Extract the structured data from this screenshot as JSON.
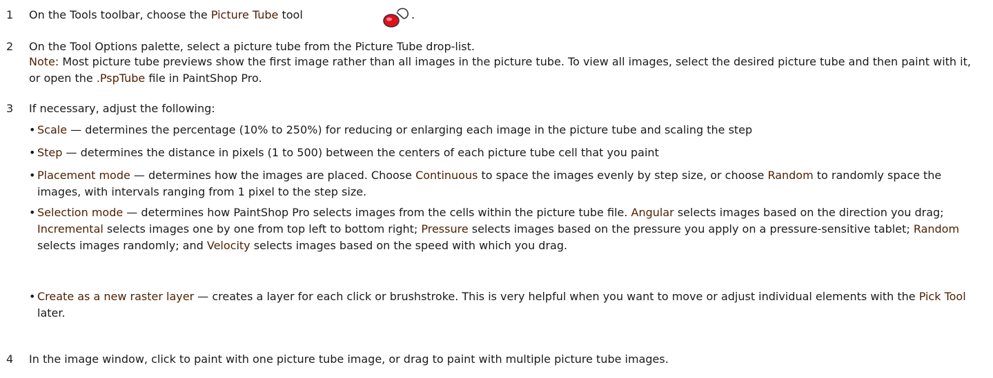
{
  "steps": [
    {
      "n": "1",
      "text": {
        "a": "On the Tools toolbar, choose the ",
        "b": "Picture Tube",
        "c": " tool ",
        "d": "."
      }
    },
    {
      "n": "2",
      "text": "On the Tool Options palette, select a picture tube from the Picture Tube drop-list.",
      "note": {
        "label": "Note",
        "sep": ":",
        "a": " Most picture tube previews show the first image rather than all images in the picture tube. To view all images, select the desired picture tube and then paint with it, or open the ",
        "kw": ".PspTube",
        "b": " file in PaintShop Pro."
      }
    },
    {
      "n": "3",
      "text": "If necessary, adjust the following:"
    },
    {
      "n": "4",
      "text": "In the image window, click to paint with one picture tube image, or drag to paint with multiple picture tube images."
    }
  ],
  "bullets": {
    "scale": {
      "kw": "Scale",
      "rest": " — determines the percentage (10% to 250%) for reducing or enlarging each image in the picture tube and scaling the step"
    },
    "step": {
      "kw": "Step",
      "rest": " — determines the distance in pixels (1 to 500) between the centers of each picture tube cell that you paint"
    },
    "placement": {
      "kw": "Placement mode",
      "a": " — determines how the images are placed. Choose ",
      "kw2": "Continuous",
      "b": " to space the images evenly by step size, or choose ",
      "kw3": "Random",
      "c": " to randomly space the images, with intervals ranging from 1 pixel to the step size."
    },
    "selection": {
      "kw": "Selection mode",
      "a": " — determines how PaintShop Pro selects images from the cells within the picture tube file. ",
      "k1": "Angular",
      "b": " selects images based on the direction you drag; ",
      "k2": "Incremental",
      "c": " selects images one by one from top left to bottom right; ",
      "k3": "Pressure",
      "d": " selects images based on the pressure you apply on a pressure-sensitive tablet; ",
      "k4": "Random",
      "e": " selects images randomly; and ",
      "k5": "Velocity",
      "f": " selects images based on the speed with which you drag."
    },
    "raster": {
      "kw": "Create as a new raster layer",
      "a": " — creates a layer for each click or brushstroke. This is very helpful when you want to move or adjust individual elements with the ",
      "k1": "Pick Tool",
      "b": " later."
    }
  },
  "bullet_char": "•",
  "icons": {
    "tool": "picture-tube-icon"
  },
  "colors": {
    "keyword": "#4d1f00",
    "icon_red": "#e0101a"
  }
}
